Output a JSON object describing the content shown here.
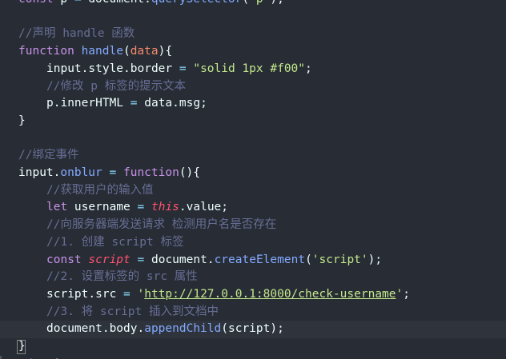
{
  "lines": [
    {
      "indent": 0,
      "tokens": [
        {
          "c": "t-kw",
          "t": "const"
        },
        {
          "c": "t-var",
          "t": " p "
        },
        {
          "c": "t-punc",
          "t": "="
        },
        {
          "c": "t-var",
          "t": " document."
        },
        {
          "c": "t-fn",
          "t": "querySelector"
        },
        {
          "c": "t-var",
          "t": "("
        },
        {
          "c": "t-str",
          "t": "'p'"
        },
        {
          "c": "t-var",
          "t": ");"
        }
      ]
    },
    {
      "indent": 0,
      "tokens": []
    },
    {
      "indent": 0,
      "tokens": [
        {
          "c": "t-cmt",
          "t": "//声明 handle 函数"
        }
      ]
    },
    {
      "indent": 0,
      "tokens": [
        {
          "c": "t-kw",
          "t": "function"
        },
        {
          "c": "t-var",
          "t": " "
        },
        {
          "c": "t-fn",
          "t": "handle"
        },
        {
          "c": "t-var",
          "t": "("
        },
        {
          "c": "t-param",
          "t": "data"
        },
        {
          "c": "t-var",
          "t": "){"
        }
      ]
    },
    {
      "indent": 1,
      "tokens": [
        {
          "c": "t-var",
          "t": "input.style.border "
        },
        {
          "c": "t-punc",
          "t": "="
        },
        {
          "c": "t-var",
          "t": " "
        },
        {
          "c": "t-str",
          "t": "\"solid 1px #f00\""
        },
        {
          "c": "t-var",
          "t": ";"
        }
      ]
    },
    {
      "indent": 1,
      "tokens": [
        {
          "c": "t-cmt",
          "t": "//修改 p 标签的提示文本"
        }
      ]
    },
    {
      "indent": 1,
      "tokens": [
        {
          "c": "t-var",
          "t": "p.innerHTML "
        },
        {
          "c": "t-punc",
          "t": "="
        },
        {
          "c": "t-var",
          "t": " data.msg;"
        }
      ]
    },
    {
      "indent": 0,
      "tokens": [
        {
          "c": "t-var",
          "t": "}"
        }
      ]
    },
    {
      "indent": 0,
      "tokens": []
    },
    {
      "indent": 0,
      "tokens": [
        {
          "c": "t-cmt",
          "t": "//绑定事件"
        }
      ]
    },
    {
      "indent": 0,
      "tokens": [
        {
          "c": "t-var",
          "t": "input."
        },
        {
          "c": "t-fn",
          "t": "onblur"
        },
        {
          "c": "t-var",
          "t": " "
        },
        {
          "c": "t-punc",
          "t": "="
        },
        {
          "c": "t-var",
          "t": " "
        },
        {
          "c": "t-kw",
          "t": "function"
        },
        {
          "c": "t-var",
          "t": "(){"
        }
      ]
    },
    {
      "indent": 1,
      "tokens": [
        {
          "c": "t-cmt",
          "t": "//获取用户的输入值"
        }
      ]
    },
    {
      "indent": 1,
      "tokens": [
        {
          "c": "t-kw",
          "t": "let"
        },
        {
          "c": "t-var",
          "t": " username "
        },
        {
          "c": "t-punc",
          "t": "="
        },
        {
          "c": "t-var",
          "t": " "
        },
        {
          "c": "t-this",
          "t": "this"
        },
        {
          "c": "t-var",
          "t": ".value;"
        }
      ]
    },
    {
      "indent": 1,
      "tokens": [
        {
          "c": "t-cmt",
          "t": "//向服务器端发送请求 检测用户名是否存在"
        }
      ]
    },
    {
      "indent": 1,
      "tokens": [
        {
          "c": "t-cmt",
          "t": "//1. 创建 script 标签"
        }
      ]
    },
    {
      "indent": 1,
      "tokens": [
        {
          "c": "t-kw",
          "t": "const"
        },
        {
          "c": "t-var",
          "t": " "
        },
        {
          "c": "t-this",
          "t": "script"
        },
        {
          "c": "t-var",
          "t": " "
        },
        {
          "c": "t-punc",
          "t": "="
        },
        {
          "c": "t-var",
          "t": " document."
        },
        {
          "c": "t-fn",
          "t": "createElement"
        },
        {
          "c": "t-var",
          "t": "("
        },
        {
          "c": "t-str",
          "t": "'script'"
        },
        {
          "c": "t-var",
          "t": ");"
        }
      ]
    },
    {
      "indent": 1,
      "tokens": [
        {
          "c": "t-cmt",
          "t": "//2. 设置标签的 src 属性"
        }
      ]
    },
    {
      "indent": 1,
      "tokens": [
        {
          "c": "t-var",
          "t": "script.src "
        },
        {
          "c": "t-punc",
          "t": "="
        },
        {
          "c": "t-var",
          "t": " "
        },
        {
          "c": "t-str",
          "t": "'"
        },
        {
          "c": "t-url",
          "t": "http://127.0.0.1:8000/check-username"
        },
        {
          "c": "t-str",
          "t": "'"
        },
        {
          "c": "t-var",
          "t": ";"
        }
      ]
    },
    {
      "indent": 1,
      "tokens": [
        {
          "c": "t-cmt",
          "t": "//3. 将 script 插入到文档中"
        }
      ]
    },
    {
      "indent": 1,
      "tokens": [
        {
          "c": "t-var",
          "t": "document.body."
        },
        {
          "c": "t-fn",
          "t": "appendChild"
        },
        {
          "c": "t-var",
          "t": "(script);"
        }
      ]
    },
    {
      "indent": 0,
      "tokens": [
        {
          "c": "t-var",
          "t": "}"
        }
      ]
    },
    {
      "indent": 0,
      "tokens": [
        {
          "c": "t-kw",
          "t": "</"
        },
        {
          "c": "t-kw",
          "t": "script"
        },
        {
          "c": "t-kw",
          "t": ">"
        }
      ]
    }
  ],
  "current_line_index": 19,
  "colors": {
    "background": "#282c34",
    "current_line": "#2f333c",
    "keyword": "#c792ea",
    "function": "#82aaff",
    "string": "#c3e88d",
    "comment": "#676e95",
    "this": "#ff5370",
    "param": "#f78c6c"
  }
}
